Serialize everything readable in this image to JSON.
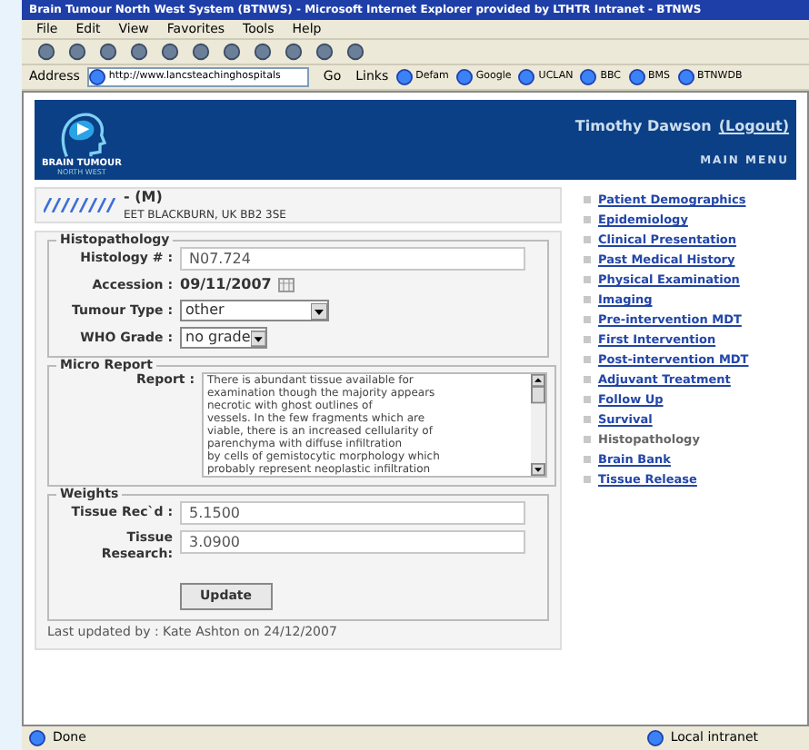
{
  "window": {
    "title": "Brain Tumour North West System (BTNWS) - Microsoft Internet Explorer provided by LTHTR Intranet - BTNWS"
  },
  "menu": [
    "File",
    "Edit",
    "View",
    "Favorites",
    "Tools",
    "Help"
  ],
  "address": {
    "label": "Address",
    "value": "http://www.lancsteachinghospitals",
    "go": "Go",
    "links_label": "Links",
    "links": [
      "Defam",
      "Google",
      "UCLAN",
      "BBC",
      "BMS",
      "BTNWDB"
    ]
  },
  "header": {
    "logo_line_1": "BRAIN TUMOUR",
    "logo_line_2": "NORTH WEST",
    "user": "Timothy Dawson",
    "logout": "(Logout)",
    "main_menu": "MAIN MENU"
  },
  "patient": {
    "sex": "- (M)",
    "address": "EET BLACKBURN, UK BB2 3SE"
  },
  "histopathology": {
    "legend": "Histopathology",
    "histology_label": "Histology # :",
    "histology_value": "N07.724",
    "accession_label": "Accession :",
    "accession_value": "09/11/2007",
    "tumour_type_label": "Tumour Type :",
    "tumour_type_value": "other",
    "who_grade_label": "WHO Grade :",
    "who_grade_value": "no grade"
  },
  "micro_report": {
    "legend": "Micro Report",
    "report_label": "Report :",
    "report_value": "There is abundant tissue available for\nexamination though the majority appears\nnecrotic with ghost outlines of\nvessels. In the few fragments which are\nviable, there is an increased cellularity of\nparenchyma with diffuse infiltration\nby cells of gemistocytic morphology which\nprobably represent neoplastic infiltration"
  },
  "weights": {
    "legend": "Weights",
    "received_label": "Tissue Rec`d :",
    "received_value": "5.1500",
    "research_label_1": "Tissue",
    "research_label_2": "Research:",
    "research_value": "3.0900",
    "button": "Update"
  },
  "last_updated": "Last updated by : Kate Ashton on 24/12/2007",
  "sidebar": {
    "items": [
      {
        "label": "Patient Demographics",
        "selected": false
      },
      {
        "label": "Epidemiology",
        "selected": false
      },
      {
        "label": "Clinical Presentation",
        "selected": false
      },
      {
        "label": "Past Medical History",
        "selected": false
      },
      {
        "label": "Physical Examination",
        "selected": false
      },
      {
        "label": "Imaging",
        "selected": false
      },
      {
        "label": "Pre-intervention MDT",
        "selected": false
      },
      {
        "label": "First Intervention",
        "selected": false
      },
      {
        "label": "Post-intervention MDT",
        "selected": false
      },
      {
        "label": "Adjuvant Treatment",
        "selected": false
      },
      {
        "label": "Follow Up",
        "selected": false
      },
      {
        "label": "Survival",
        "selected": false
      },
      {
        "label": "Histopathology",
        "selected": true
      },
      {
        "label": "Brain Bank",
        "selected": false
      },
      {
        "label": "Tissue Release",
        "selected": false
      }
    ]
  },
  "status_bar": {
    "text": "Done",
    "zone": "Local intranet"
  }
}
